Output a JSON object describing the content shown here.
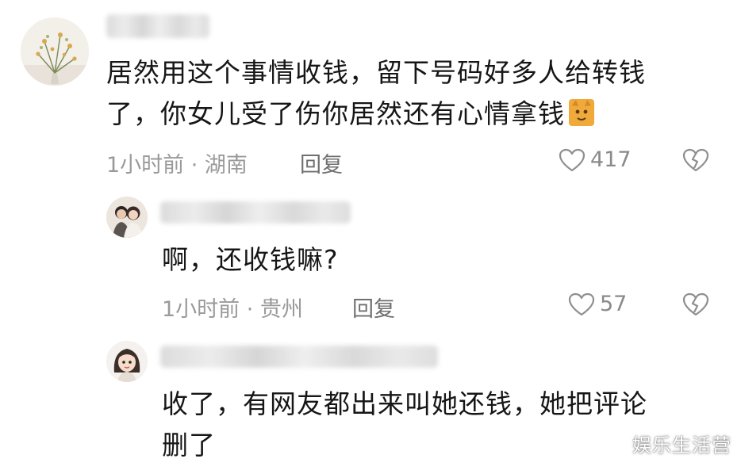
{
  "comments": [
    {
      "text_line1": "居然用这个事情收钱，留下号码好多人给转钱",
      "text_line2": "了，你女儿受了伤你居然还有心情拿钱",
      "time": "1小时前 · 湖南",
      "reply_label": "回复",
      "likes": "417",
      "emoji_icon": "cat-face-emoji"
    },
    {
      "text": "啊，还收钱嘛?",
      "time": "1小时前 · 贵州",
      "reply_label": "回复",
      "likes": "57"
    },
    {
      "text_line1": "收了，有网友都出来叫她还钱，她把评论",
      "text_line2": "删了"
    }
  ],
  "icons": {
    "like": "heart-outline-icon",
    "dislike": "broken-heart-icon"
  },
  "colors": {
    "text": "#161616",
    "meta": "#9a9a9a",
    "reply": "#6f6f6f",
    "icon": "#8f8f8f"
  },
  "watermark": "娱乐生活营"
}
